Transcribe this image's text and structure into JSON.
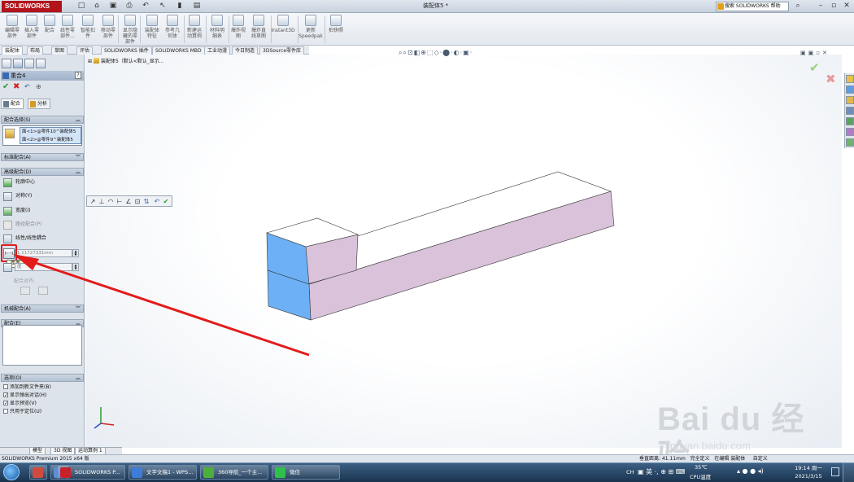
{
  "titlebar": {
    "app_logo": "SOLIDWORKS",
    "document_title": "装配体5 *",
    "help_search_placeholder": "搜索 SOLIDWORKS 帮助"
  },
  "command_manager": {
    "buttons": [
      {
        "label": "编辑零\n部件"
      },
      {
        "label": "插入零\n部件"
      },
      {
        "label": "配合"
      },
      {
        "label": "线性零\n部件..."
      },
      {
        "label": "智能扣\n件"
      },
      {
        "label": "移动零\n部件"
      },
      {
        "label": "显示隐\n藏的零\n部件"
      },
      {
        "label": "装配体\n特征"
      },
      {
        "label": "参考几\n何体"
      },
      {
        "label": "新建运\n动算例"
      },
      {
        "label": "材料明\n细表"
      },
      {
        "label": "爆炸视\n图"
      },
      {
        "label": "爆炸直\n线草图"
      },
      {
        "label": "Instant3D"
      },
      {
        "label": "更新\nSpeedpak"
      },
      {
        "label": "拍快照"
      }
    ]
  },
  "tabs": [
    "装配体",
    "布局",
    "草图",
    "评估",
    "SOLIDWORKS 插件",
    "SOLIDWORKS MBD",
    "工业动漫",
    "今日制造",
    "3DSource零件库"
  ],
  "property_manager": {
    "title": "重合4",
    "subtabs": [
      "配合",
      "分析"
    ],
    "groups": {
      "selections": "配合选择(S)",
      "standard": "标准配合(A)",
      "advanced": "高级配合(D)",
      "mechanical": "机械配合(A)",
      "mates": "配合(E)",
      "options": "选项(O)"
    },
    "selection_items": [
      "面<1>@零件10^装配体5",
      "面<2>@零件9^装配体5"
    ],
    "advanced_items": [
      {
        "label": "轮廓中心",
        "enabled": true
      },
      {
        "label": "对称(Y)",
        "enabled": true
      },
      {
        "label": "宽度(I)",
        "enabled": true
      },
      {
        "label": "路径配合(P)",
        "enabled": false
      },
      {
        "label": "线性/线性耦合",
        "enabled": true
      }
    ],
    "distance_value": "1.11727331mm",
    "angle_value": "度",
    "distance_tooltip": "距离",
    "alignment_label": "配合对齐:",
    "options": [
      {
        "label": "添加到新文件夹(B)",
        "checked": false
      },
      {
        "label": "显示弹出对话(H)",
        "checked": true
      },
      {
        "label": "显示预览(V)",
        "checked": true
      },
      {
        "label": "只用于定位(U)",
        "checked": false
      }
    ]
  },
  "bottom_tabs": [
    "模型",
    "3D 视图",
    "运动算例 1"
  ],
  "graphics": {
    "tree_flyout": "装配体5（默认<默认_显示..."
  },
  "statusbar": {
    "left": "SOLIDWORKS Premium 2015 x64 版",
    "right_items": [
      "垂直距离: 41.11mm",
      "完全定义",
      "在编辑 装配体",
      "自定义"
    ]
  },
  "watermark": {
    "logo_text": "Bai du 经验",
    "url": "jingyan.baidu.com"
  },
  "taskbar": {
    "items": [
      {
        "label": "",
        "color": "#d04b3f"
      },
      {
        "label": "",
        "color": "#5c8fd6"
      },
      {
        "label": "SOLIDWORKS P...",
        "color": "#c8212b"
      },
      {
        "label": "文字文稿1 - WPS...",
        "color": "#3f7bd9"
      },
      {
        "label": "360导航_一个主...",
        "color": "#4caf3c"
      },
      {
        "label": "微信",
        "color": "#2ec04a"
      }
    ],
    "tray": {
      "ime": "CH",
      "temperature": "35℃",
      "temperature_label": "CPU温度"
    },
    "clock": {
      "time": "19:14 周一",
      "date": "2021/3/15"
    }
  },
  "colors": {
    "highlight": "#e21c1c",
    "part_top": "#ffffff",
    "part_side": "#d9c2da",
    "part_selected_face": "#6db0f5",
    "arrow": "#e21c1c"
  }
}
